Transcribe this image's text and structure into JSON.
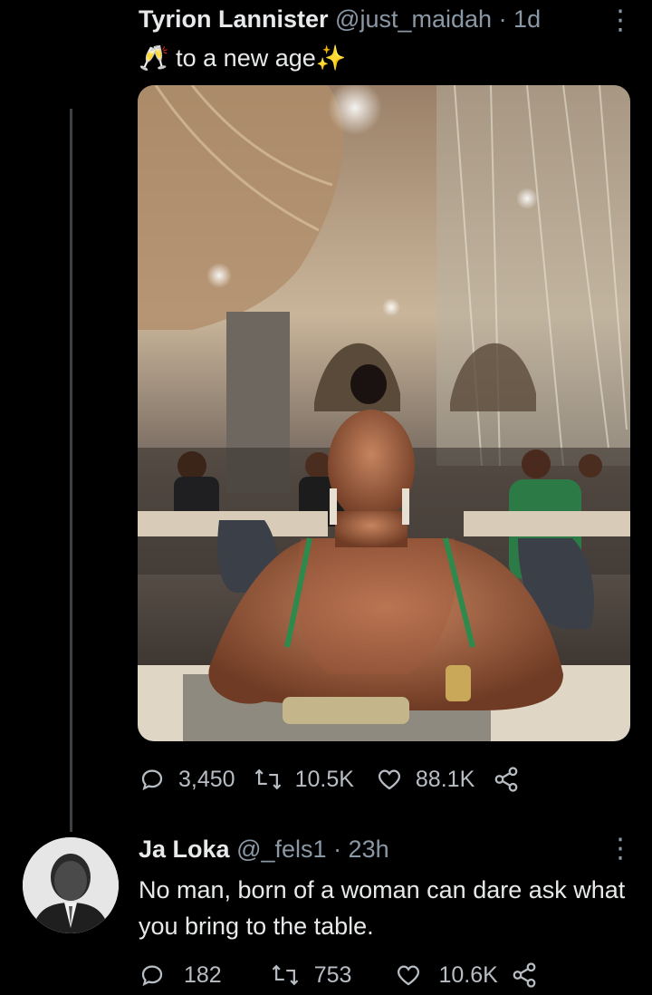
{
  "tweet": {
    "author_name": "Tyrion Lannister",
    "author_handle": "@just_maidah",
    "time": "· 1d",
    "emoji_prefix": "🥂",
    "text": "to a new age",
    "emoji_suffix": "✨",
    "stats": {
      "replies": "3,450",
      "retweets": "10.5K",
      "likes": "88.1K"
    }
  },
  "reply": {
    "author_name": "Ja Loka",
    "author_handle": "@_fels1",
    "time": "· 23h",
    "text": "No man, born of a woman can dare ask what you bring to the table.",
    "stats": {
      "replies": "182",
      "retweets": "753",
      "likes": "10.6K"
    }
  },
  "icons": {
    "reply": "reply-icon",
    "retweet": "retweet-icon",
    "like": "heart-icon",
    "share": "share-icon",
    "more": "more-icon"
  },
  "colors": {
    "background": "#000000",
    "text": "#e7e9ea",
    "secondary": "#8b98a5",
    "thread_line": "#3e4144"
  }
}
